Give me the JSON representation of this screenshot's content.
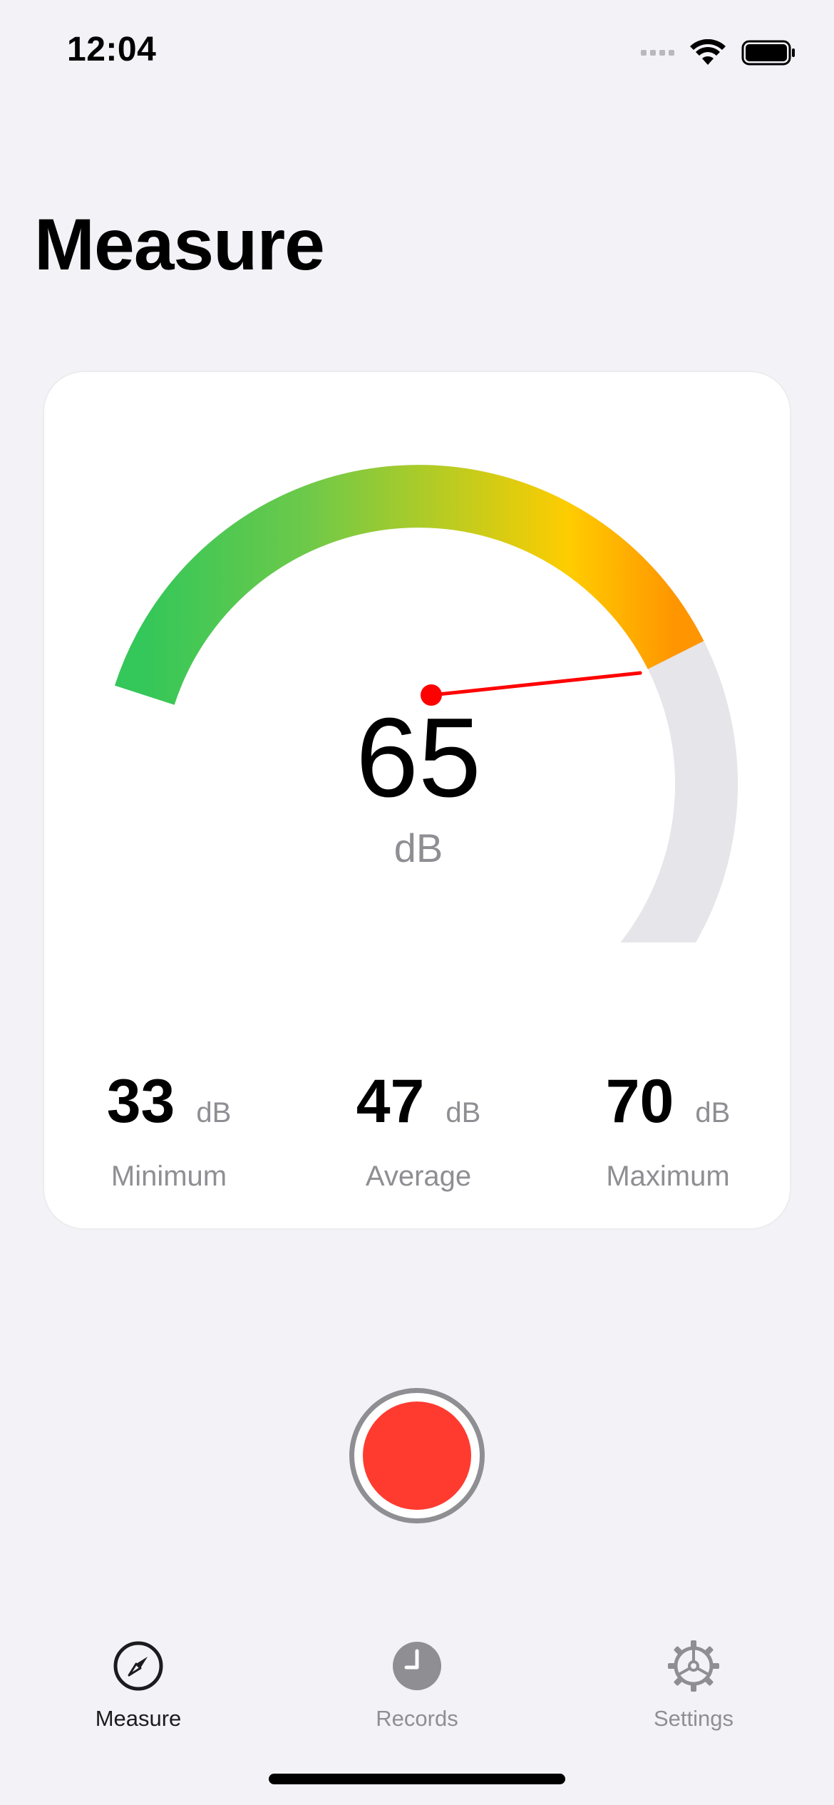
{
  "status_bar": {
    "time": "12:04"
  },
  "page": {
    "title": "Measure"
  },
  "meter": {
    "current_value": "65",
    "unit": "dB",
    "level_fraction": 0.47,
    "gauge_colors": [
      "#34c759",
      "#7ac943",
      "#ffcc00",
      "#ff9500"
    ],
    "track_color": "#e5e5ea",
    "needle_color": "#ff0000"
  },
  "stats": [
    {
      "value": "33",
      "unit": "dB",
      "label": "Minimum"
    },
    {
      "value": "47",
      "unit": "dB",
      "label": "Average"
    },
    {
      "value": "70",
      "unit": "dB",
      "label": "Maximum"
    }
  ],
  "record_button": {
    "icon": "record-icon",
    "color": "#ff3b30"
  },
  "tab_bar": {
    "items": [
      {
        "label": "Measure",
        "icon": "compass-icon",
        "active": true
      },
      {
        "label": "Records",
        "icon": "clock-icon",
        "active": false
      },
      {
        "label": "Settings",
        "icon": "gear-icon",
        "active": false
      }
    ]
  }
}
